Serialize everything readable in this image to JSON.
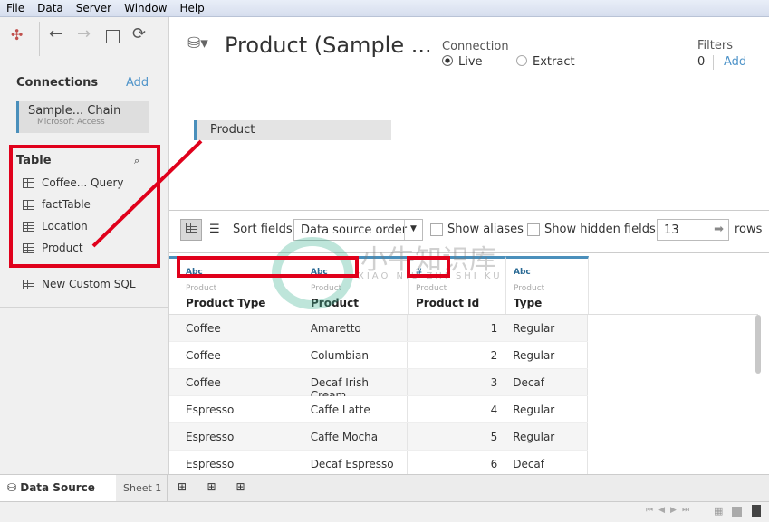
{
  "menu": [
    "File",
    "Data",
    "Server",
    "Window",
    "Help"
  ],
  "left": {
    "connections_title": "Connections",
    "add_label": "Add",
    "connection": {
      "name": "Sample... Chain",
      "type": "Microsoft Access"
    },
    "table_title": "Table",
    "tables": [
      "Coffee... Query",
      "factTable",
      "Location",
      "Product"
    ],
    "custom_sql": "New Custom SQL"
  },
  "header": {
    "title": "Product (Sample ...",
    "connection_label": "Connection",
    "live": "Live",
    "extract": "Extract",
    "connection_selected": "Live",
    "filters_label": "Filters",
    "filters_count": "0",
    "filters_add": "Add"
  },
  "canvas": {
    "table": "Product"
  },
  "toolbar": {
    "sort_label": "Sort fields",
    "sort_value": "Data source order",
    "show_aliases": "Show aliases",
    "show_hidden": "Show hidden fields",
    "rows_value": "13",
    "rows_label": "rows"
  },
  "columns": [
    {
      "type": "Abc",
      "source": "Product",
      "name": "Product Type"
    },
    {
      "type": "Abc",
      "source": "Product",
      "name": "Product"
    },
    {
      "type": "#",
      "source": "Product",
      "name": "Product Id"
    },
    {
      "type": "Abc",
      "source": "Product",
      "name": "Type"
    }
  ],
  "rows": [
    [
      "Coffee",
      "Amaretto",
      "1",
      "Regular"
    ],
    [
      "Coffee",
      "Columbian",
      "2",
      "Regular"
    ],
    [
      "Coffee",
      "Decaf Irish Cream",
      "3",
      "Decaf"
    ],
    [
      "Espresso",
      "Caffe Latte",
      "4",
      "Regular"
    ],
    [
      "Espresso",
      "Caffe Mocha",
      "5",
      "Regular"
    ],
    [
      "Espresso",
      "Decaf Espresso",
      "6",
      "Decaf"
    ]
  ],
  "tabs": {
    "data_source": "Data Source",
    "sheet1": "Sheet 1"
  },
  "watermark": {
    "cn": "小牛知识库",
    "en": "XIAO NIU ZHI SHI KU"
  },
  "colors": {
    "accent": "#4f94c9",
    "annotation": "#e0001b"
  }
}
